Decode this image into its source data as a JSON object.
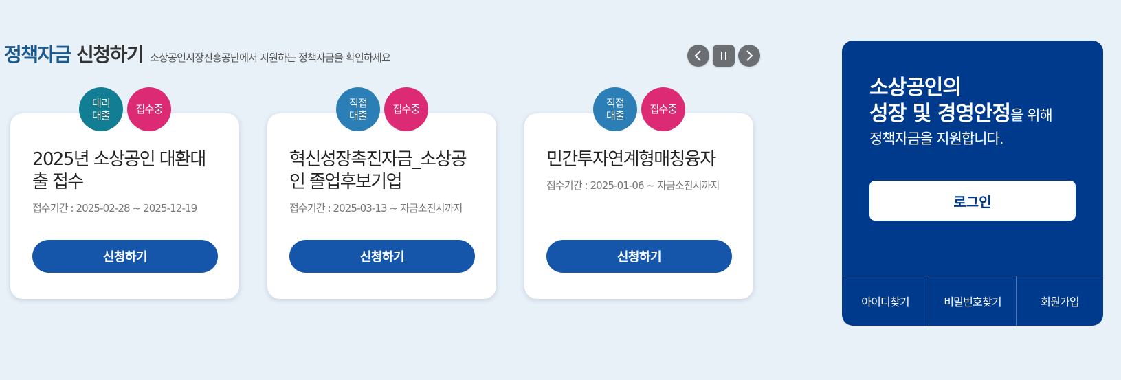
{
  "header": {
    "title_accent": "정책자금",
    "title_main": "신청하기",
    "subtitle": "소상공인시장진흥공단에서 지원하는 정책자금을 확인하세요"
  },
  "carousel_controls": {
    "prev_icon": "chevron-left-icon",
    "pause_icon": "pause-icon",
    "next_icon": "chevron-right-icon"
  },
  "cards": [
    {
      "type_label": "대리 대출",
      "type_color": "#127e93",
      "status_label": "접수중",
      "status_color": "#dc2b74",
      "title": "2025년 소상공인 대환대출 접수",
      "period": "접수기간 : 2025-02-28 ~ 2025-12-19",
      "button_label": "신청하기"
    },
    {
      "type_label": "직접 대출",
      "type_color": "#2c7fb6",
      "status_label": "접수중",
      "status_color": "#dc2b74",
      "title": "혁신성장촉진자금_소상공인 졸업후보기업",
      "period": "접수기간 : 2025-03-13 ~ 자금소진시까지",
      "button_label": "신청하기"
    },
    {
      "type_label": "직접 대출",
      "type_color": "#2c7fb6",
      "status_label": "접수중",
      "status_color": "#dc2b74",
      "title": "민간투자연계형매칭융자",
      "period": "접수기간 : 2025-01-06 ~ 자금소진시까지",
      "button_label": "신청하기"
    }
  ],
  "side_panel": {
    "line1": "소상공인의",
    "line2_bold": "성장 및 경영안정",
    "line2_rest": "을 위해",
    "line3": "정책자금을 지원합니다.",
    "login_label": "로그인",
    "links": [
      "아이디찾기",
      "비밀번호찾기",
      "회원가입"
    ],
    "background_color": "#003a8c"
  }
}
